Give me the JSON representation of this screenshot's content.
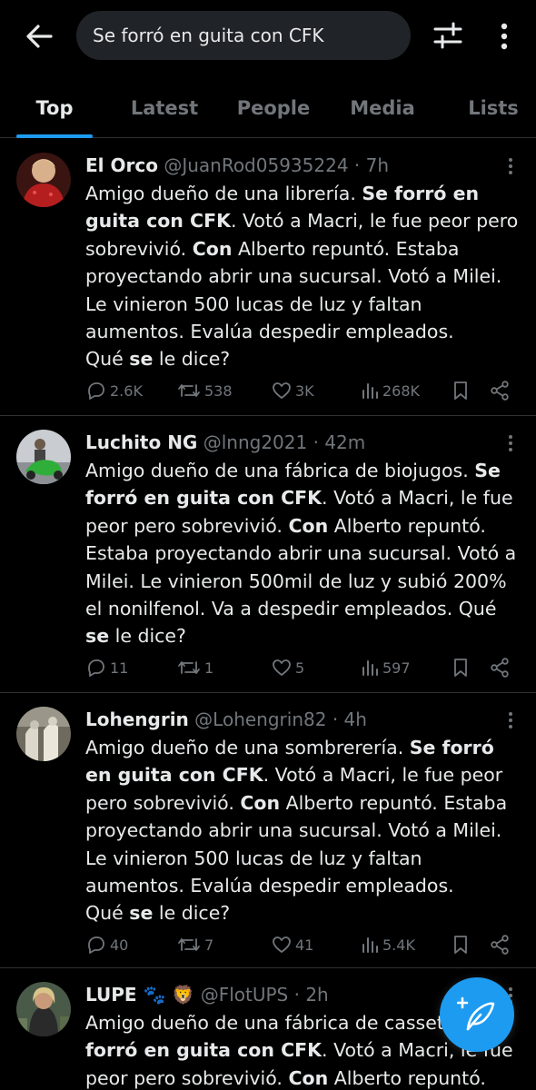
{
  "search": {
    "query": "Se forró en guita con CFK"
  },
  "tabs": [
    {
      "label": "Top",
      "active": true
    },
    {
      "label": "Latest",
      "active": false
    },
    {
      "label": "People",
      "active": false
    },
    {
      "label": "Media",
      "active": false
    },
    {
      "label": "Lists",
      "active": false
    }
  ],
  "tweets": [
    {
      "name": "El Orco",
      "handle": "@JuanRod05935224",
      "sep": "·",
      "time": "7h",
      "text": [
        "Amigo dueño de una librería. ",
        "Se forró en guita con CFK",
        ". Votó a Macri, le fue peor pero sobrevivió. ",
        "Con",
        " Alberto repuntó. Estaba proyectando abrir una sucursal. Votó a Milei. Le vinieron 500 lucas de luz y faltan aumentos. Evalúa despedir empleados. ",
        "Qué ",
        "se",
        " le dice?"
      ],
      "replies": "2.6K",
      "reposts": "538",
      "likes": "3K",
      "views": "268K"
    },
    {
      "name": "Luchito NG",
      "handle": "@lnng2021",
      "sep": "·",
      "time": "42m",
      "text": [
        "Amigo dueño de una fábrica de biojugos. ",
        "Se forró en guita con CFK",
        ". Votó a Macri, le fue peor pero sobrevivió. ",
        "Con",
        " Alberto repuntó. Estaba proyectando abrir una sucursal. Votó a Milei. Le vinieron 500mil de luz y subió 200% el nonilfenol. Va a despedir empleados.  Qué ",
        "se",
        " le dice?"
      ],
      "replies": "11",
      "reposts": "1",
      "likes": "5",
      "views": "597"
    },
    {
      "name": "Lohengrin",
      "handle": "@Lohengrin82",
      "sep": "·",
      "time": "4h",
      "text": [
        "Amigo dueño de una sombrerería. ",
        "Se forró en guita con CFK",
        ". Votó a Macri, le fue peor pero sobrevivió. ",
        "Con",
        " Alberto repuntó. Estaba proyectando abrir una sucursal. Votó a Milei. Le vinieron 500 lucas de luz y faltan aumentos. Evalúa despedir empleados. ",
        "Qué ",
        "se",
        " le dice?"
      ],
      "replies": "40",
      "reposts": "7",
      "likes": "41",
      "views": "5.4K"
    },
    {
      "name": "LUPE 🐾 🦁",
      "handle": "@FlotUPS",
      "sep": "·",
      "time": "2h",
      "text": [
        "Amigo dueño de una fábrica de cassettes. Se ",
        "forró en guita con CFK",
        ". Votó a Macri, le fue peor pero sobrevivió. ",
        "Con",
        " Alberto repuntó."
      ]
    }
  ],
  "colors": {
    "accent": "#1d9bf0",
    "text": "#e7e9ea",
    "muted": "#71767b",
    "border": "#2f3336",
    "background": "#000000"
  }
}
